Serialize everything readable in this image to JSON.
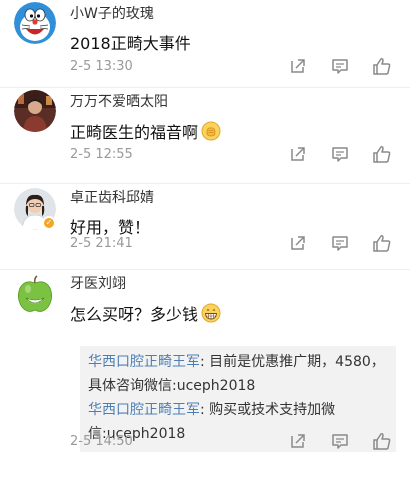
{
  "comments": [
    {
      "username": "小W子的玫瑰",
      "text": "2018正畸大事件",
      "time": "2-5 13:30",
      "avatar": "doraemon-avatar",
      "verified": false,
      "emoji": null
    },
    {
      "username": "万万不爱晒太阳",
      "text": "正畸医生的福音啊",
      "time": "2-5 12:55",
      "avatar": "photo-avatar",
      "verified": false,
      "emoji": "fist-bump-emoji"
    },
    {
      "username": "卓正齿科邱婧",
      "text": "好用，赞！",
      "time": "2-5 21:41",
      "avatar": "doctor-avatar",
      "verified": true,
      "emoji": null
    },
    {
      "username": "牙医刘翊",
      "text": "怎么买呀？多少钱",
      "time": "2-5 14:50",
      "avatar": "green-apple-avatar",
      "verified": false,
      "emoji": "grinning-emoji",
      "replies": [
        {
          "author": "华西口腔正畸王军",
          "text": ": 目前是优惠推广期，4580，具体咨询微信:uceph2018"
        },
        {
          "author": "华西口腔正畸王军",
          "text": ": 购买或技术支持加微信:uceph2018"
        }
      ]
    }
  ],
  "icons": {
    "share": "share-icon",
    "comment": "comment-icon",
    "like": "thumbs-up-icon"
  },
  "colors": {
    "reply_author": "#4d7fb3",
    "time": "#999999",
    "reply_bg": "#f2f2f2"
  }
}
